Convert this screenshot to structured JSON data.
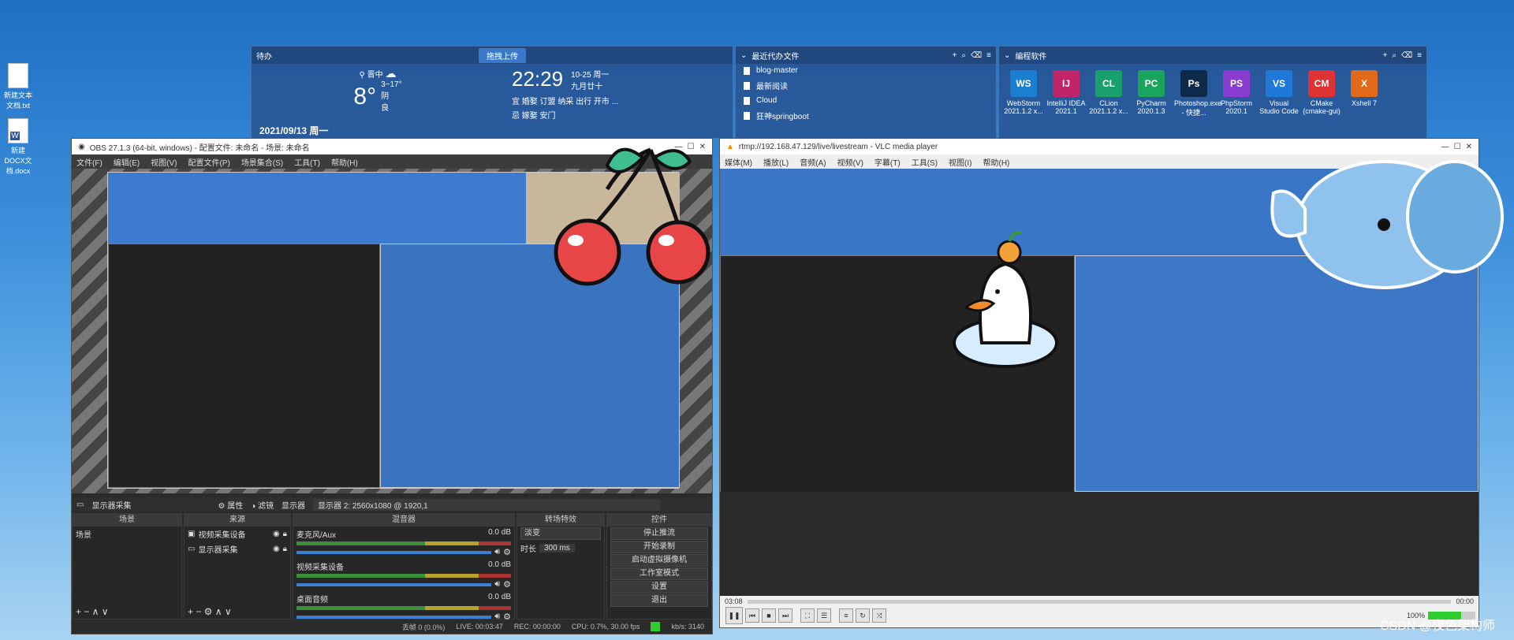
{
  "desktop": {
    "icons": [
      {
        "label": "新建文本文档.txt"
      },
      {
        "label": "新建DOCX文档.docx"
      }
    ]
  },
  "widget_weather": {
    "title": "待办",
    "upload_label": "拖拽上传",
    "location": "晋中",
    "temp": "8°",
    "range": "3~17°",
    "cond1": "阴",
    "cond2": "良",
    "time": "22:29",
    "date_line1": "10-25 周一",
    "date_line2": "九月廿十",
    "line_a": "宜 婚娶 订盟 纳采 出行 开市 ...",
    "line_b": "忌 嫁娶 安门",
    "footer_date": "2021/09/13  周一"
  },
  "widget_files": {
    "title": "最近代办文件",
    "items": [
      "blog-master",
      "最新阅读",
      "Cloud",
      "狂神springboot"
    ]
  },
  "widget_apps": {
    "title": "编程软件",
    "apps": [
      {
        "name": "WebStorm 2021.1.2 x...",
        "abbr": "WS",
        "color": "#1a7fd0"
      },
      {
        "name": "IntelliJ IDEA 2021.1",
        "abbr": "IJ",
        "color": "#c0256a"
      },
      {
        "name": "CLion 2021.1.2 x...",
        "abbr": "CL",
        "color": "#1aa06b"
      },
      {
        "name": "PyCharm 2020.1.3",
        "abbr": "PC",
        "color": "#1ba55c"
      },
      {
        "name": "Photoshop.exe - 快捷...",
        "abbr": "Ps",
        "color": "#0e2a4a"
      },
      {
        "name": "PhpStorm 2020.1",
        "abbr": "PS",
        "color": "#8a3bd0"
      },
      {
        "name": "Visual Studio Code",
        "abbr": "VS",
        "color": "#1e7ad6"
      },
      {
        "name": "CMake (cmake-gui)",
        "abbr": "CM",
        "color": "#d33"
      },
      {
        "name": "Xshell 7",
        "abbr": "X",
        "color": "#e06a1a"
      }
    ]
  },
  "obs": {
    "title": "OBS 27.1.3 (64-bit, windows) - 配置文件: 未命名 - 场景: 未命名",
    "menu": [
      "文件(F)",
      "编辑(E)",
      "视图(V)",
      "配置文件(P)",
      "场景集合(S)",
      "工具(T)",
      "帮助(H)"
    ],
    "source_bar": {
      "name": "显示器采集",
      "props": "属性",
      "filters": "滤镜",
      "display": "显示器",
      "display_value": "显示器 2: 2560x1080 @ 1920,1"
    },
    "docks": {
      "scenes": "场景",
      "sources": "来源",
      "mixer": "混音器",
      "transitions": "转场特效",
      "controls": "控件"
    },
    "scene_item": "场景",
    "sources": [
      "视频采集设备",
      "显示器采集"
    ],
    "mixer": [
      {
        "name": "麦克风/Aux",
        "db": "0.0 dB"
      },
      {
        "name": "视频采集设备",
        "db": "0.0 dB"
      },
      {
        "name": "桌面音频",
        "db": "0.0 dB"
      }
    ],
    "transition": {
      "value": "淡变",
      "duration_label": "时长",
      "duration": "300 ms"
    },
    "controls": [
      "停止推流",
      "开始录制",
      "启动虚拟摄像机",
      "工作室模式",
      "设置",
      "退出"
    ],
    "status": {
      "dropped": "丢帧 0 (0.0%)",
      "live": "LIVE: 00:03:47",
      "rec": "REC: 00:00:00",
      "cpu": "CPU: 0.7%, 30.00 fps",
      "kbs": "kb/s: 3140"
    }
  },
  "vlc": {
    "title": "rtmp://192.168.47.129/live/livestream - VLC media player",
    "menu": [
      "媒体(M)",
      "播放(L)",
      "音频(A)",
      "视频(V)",
      "字幕(T)",
      "工具(S)",
      "视图(I)",
      "帮助(H)"
    ],
    "time_cur": "03:08",
    "time_end": "00:00",
    "volume": "100%"
  },
  "watermark": "CSDN @夜色架构师"
}
